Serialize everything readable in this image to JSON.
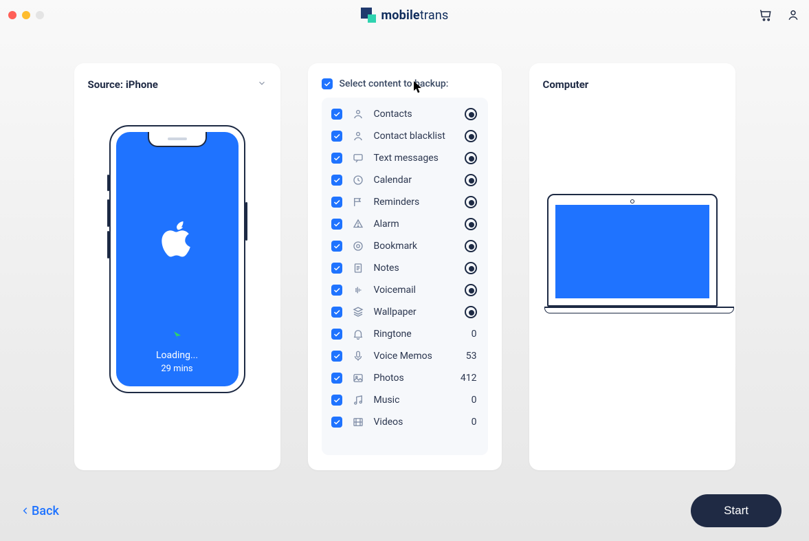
{
  "app": {
    "brand_a": "mobile",
    "brand_b": "trans"
  },
  "source": {
    "label": "Source: iPhone",
    "loading": "Loading...",
    "time": "29 mins"
  },
  "dest": {
    "label": "Computer"
  },
  "select": {
    "header": "Select content to backup:"
  },
  "items": [
    {
      "label": "Contacts",
      "icon": "user",
      "checked": true,
      "status": "loading",
      "count": null
    },
    {
      "label": "Contact blacklist",
      "icon": "user",
      "checked": true,
      "status": "loading",
      "count": null
    },
    {
      "label": "Text messages",
      "icon": "chat",
      "checked": true,
      "status": "loading",
      "count": null
    },
    {
      "label": "Calendar",
      "icon": "cal",
      "checked": true,
      "status": "loading",
      "count": null
    },
    {
      "label": "Reminders",
      "icon": "flag",
      "checked": true,
      "status": "loading",
      "count": null
    },
    {
      "label": "Alarm",
      "icon": "alarm",
      "checked": true,
      "status": "loading",
      "count": null
    },
    {
      "label": "Bookmark",
      "icon": "bookmark",
      "checked": true,
      "status": "loading",
      "count": null
    },
    {
      "label": "Notes",
      "icon": "note",
      "checked": true,
      "status": "loading",
      "count": null
    },
    {
      "label": "Voicemail",
      "icon": "voicemail",
      "checked": true,
      "status": "loading",
      "count": null
    },
    {
      "label": "Wallpaper",
      "icon": "layers",
      "checked": true,
      "status": "loading",
      "count": null
    },
    {
      "label": "Ringtone",
      "icon": "bell",
      "checked": true,
      "status": "count",
      "count": 0
    },
    {
      "label": "Voice Memos",
      "icon": "mic",
      "checked": true,
      "status": "count",
      "count": 53
    },
    {
      "label": "Photos",
      "icon": "photo",
      "checked": true,
      "status": "count",
      "count": 412
    },
    {
      "label": "Music",
      "icon": "music",
      "checked": true,
      "status": "count",
      "count": 0
    },
    {
      "label": "Videos",
      "icon": "video",
      "checked": true,
      "status": "count",
      "count": 0
    }
  ],
  "footer": {
    "back": "Back",
    "start": "Start"
  }
}
